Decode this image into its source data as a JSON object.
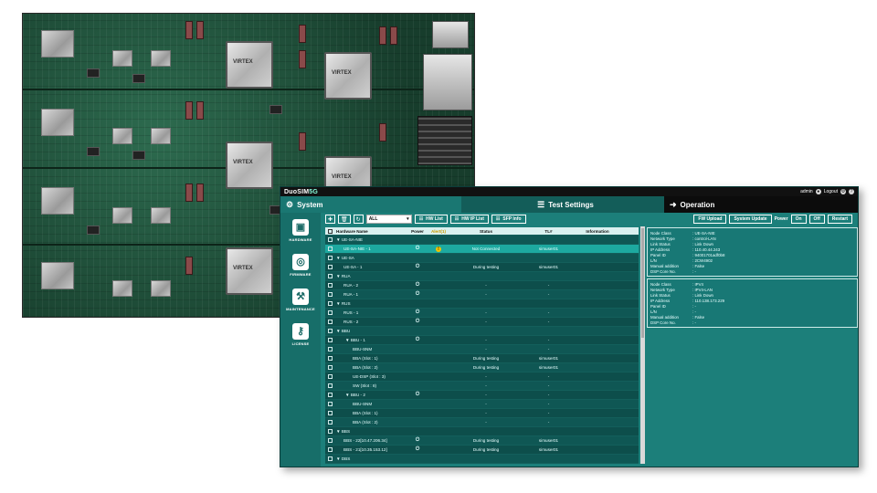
{
  "app": {
    "logo": "DuoSIM",
    "logo_suffix": "5G",
    "user": "admin",
    "logout_label": "Logout"
  },
  "menubar": {
    "system": "System",
    "test_settings": "Test Settings",
    "operation": "Operation"
  },
  "sidebar": {
    "items": [
      {
        "label": "HARDWARE",
        "icon": "chip-icon"
      },
      {
        "label": "FIRMWARE",
        "icon": "firmware-icon"
      },
      {
        "label": "MAINTENANCE",
        "icon": "maintenance-icon"
      },
      {
        "label": "LICENSE",
        "icon": "key-icon"
      }
    ]
  },
  "toolbar": {
    "filter_value": "ALL",
    "hw_list": "HW List",
    "hw_ip_list": "HW IP List",
    "sfp_info": "SFP Info"
  },
  "table": {
    "headers": {
      "name": "Hardware Name",
      "power": "Power",
      "alert": "Alert(1)",
      "status": "Status",
      "tl": "TL#",
      "info": "Information"
    },
    "rows": [
      {
        "name": "▼ UE-SA-NIE",
        "power": "",
        "alert": "",
        "status": "",
        "tl": "",
        "info": ""
      },
      {
        "name": "UE-SA-NIE - 1",
        "power": "⏻",
        "alert": "!",
        "status": "Not Connected",
        "tl": "simuser01",
        "info": ""
      },
      {
        "name": "▼ UE-SA",
        "power": "",
        "alert": "",
        "status": "",
        "tl": "",
        "info": ""
      },
      {
        "name": "UE-SA - 1",
        "power": "⏻",
        "alert": "",
        "status": "During testing",
        "tl": "simuser01",
        "info": ""
      },
      {
        "name": "▼ RUA",
        "power": "",
        "alert": "",
        "status": "",
        "tl": "",
        "info": ""
      },
      {
        "name": "RUA - 2",
        "power": "⏻",
        "alert": "",
        "status": "-",
        "tl": "-",
        "info": ""
      },
      {
        "name": "RUA - 1",
        "power": "⏻",
        "alert": "",
        "status": "-",
        "tl": "-",
        "info": ""
      },
      {
        "name": "▼ RUS",
        "power": "",
        "alert": "",
        "status": "",
        "tl": "",
        "info": ""
      },
      {
        "name": "RUS - 1",
        "power": "⏻",
        "alert": "",
        "status": "-",
        "tl": "-",
        "info": ""
      },
      {
        "name": "RUS - 2",
        "power": "⏻",
        "alert": "",
        "status": "-",
        "tl": "-",
        "info": ""
      },
      {
        "name": "▼ BBU",
        "power": "",
        "alert": "",
        "status": "",
        "tl": "",
        "info": ""
      },
      {
        "name": "▼ BBU - 1",
        "power": "⏻",
        "alert": "",
        "status": "-",
        "tl": "-",
        "info": ""
      },
      {
        "name": "BBU-SNM",
        "power": "",
        "alert": "",
        "status": "-",
        "tl": "-",
        "info": ""
      },
      {
        "name": "BBA (Slot : 1)",
        "power": "",
        "alert": "",
        "status": "During testing",
        "tl": "simuser01",
        "info": ""
      },
      {
        "name": "BBA (Slot : 2)",
        "power": "",
        "alert": "",
        "status": "During testing",
        "tl": "simuser01",
        "info": ""
      },
      {
        "name": "UE-DSP (Slot : 3)",
        "power": "",
        "alert": "",
        "status": "-",
        "tl": "-",
        "info": ""
      },
      {
        "name": "SW (Slot : 8)",
        "power": "",
        "alert": "",
        "status": "-",
        "tl": "-",
        "info": ""
      },
      {
        "name": "▼ BBU - 2",
        "power": "⏻",
        "alert": "",
        "status": "-",
        "tl": "-",
        "info": ""
      },
      {
        "name": "BBU-SNM",
        "power": "",
        "alert": "",
        "status": "-",
        "tl": "-",
        "info": ""
      },
      {
        "name": "BBA (Slot : 1)",
        "power": "",
        "alert": "",
        "status": "-",
        "tl": "-",
        "info": ""
      },
      {
        "name": "BBA (Slot : 2)",
        "power": "",
        "alert": "",
        "status": "-",
        "tl": "-",
        "info": ""
      },
      {
        "name": "▼ BBS",
        "power": "",
        "alert": "",
        "status": "",
        "tl": "",
        "info": ""
      },
      {
        "name": "BBS - 22[10.47.206.34]",
        "power": "⏻",
        "alert": "",
        "status": "During testing",
        "tl": "simuser01",
        "info": ""
      },
      {
        "name": "BBS - 21[10.35.153.12]",
        "power": "⏻",
        "alert": "",
        "status": "During testing",
        "tl": "simuser01",
        "info": ""
      },
      {
        "name": "▼ DBS",
        "power": "",
        "alert": "",
        "status": "",
        "tl": "",
        "info": ""
      },
      {
        "name": "DBS - 1 [10.42.58.6",
        "power": "⏻",
        "alert": "",
        "status": "-",
        "tl": "-",
        "info": ""
      }
    ]
  },
  "operation": {
    "fw_upload": "FW Upload",
    "system_update": "System Update",
    "power_label": "Power",
    "on": "On",
    "off": "Off",
    "restart": "Restart"
  },
  "panels": [
    [
      {
        "k": "Node Class",
        "v": ": UE-SA-NIE"
      },
      {
        "k": "Network Type",
        "v": ": control-LAN"
      },
      {
        "k": "Link Status",
        "v": ": Link Down"
      },
      {
        "k": "IP Address",
        "v": ": 110.40.44.243"
      },
      {
        "k": "Panel ID",
        "v": ": 94001701adf0b8"
      },
      {
        "k": "L/N",
        "v": ": 2CW4902"
      },
      {
        "k": "Manual addition",
        "v": ": False"
      },
      {
        "k": "DSP Core No.",
        "v": ": -"
      }
    ],
    [
      {
        "k": "Node Class",
        "v": ": IPV4"
      },
      {
        "k": "Network Type",
        "v": ": IPV4-LAN"
      },
      {
        "k": "Link Status",
        "v": ": Link Down"
      },
      {
        "k": "IP Address",
        "v": ": 110.138.173.229"
      },
      {
        "k": "Panel ID",
        "v": ": -"
      },
      {
        "k": "L/N",
        "v": ": -"
      },
      {
        "k": "Manual addition",
        "v": ": False"
      },
      {
        "k": "DSP Core No.",
        "v": ": -"
      }
    ]
  ],
  "hardware": {
    "fpga_text": "VIRTEX"
  },
  "colors": {
    "teal": "#1c7f7a",
    "selected_row": "#1da9a0",
    "operation_bar": "#0c0c0c",
    "alert_yellow": "#f2c400"
  }
}
